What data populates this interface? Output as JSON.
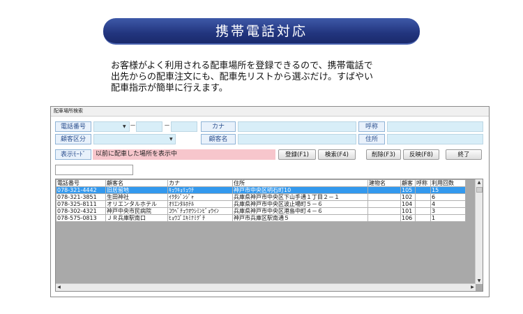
{
  "banner": {
    "title": "携帯電話対応"
  },
  "intro": {
    "lines": [
      "お客様がよく利用される配車場所を登録できるので、携帯電話で",
      "出先からの配車注文にも、配車先リストから選ぶだけ。すばやい",
      "配車指示が簡単に行えます。"
    ]
  },
  "window": {
    "title": "配車場所検索",
    "labels": {
      "phone": "電話番号",
      "kana": "カナ",
      "yobi": "呼称",
      "category": "顧客区分",
      "customer": "顧客名",
      "address": "住所",
      "mode": "表示ﾓｰﾄﾞ"
    },
    "phone_dash": "－",
    "mode_text": "以前に配車した場所を表示中",
    "buttons": {
      "register": "登録(F1)",
      "search": "検索(F4)",
      "delete": "削除(F3)",
      "reflect": "反映(F8)",
      "exit": "終了"
    },
    "table": {
      "headers": [
        "電話番号",
        "顧客名",
        "カナ",
        "住所",
        "建物名",
        "顧客",
        "呼称",
        "利用回数"
      ],
      "rows": [
        [
          "078-321-4442",
          "旧居留地",
          "ｷｭｳｷｮﾘｭｳﾁ",
          "神戸市中央区明石町10",
          "",
          "105",
          "",
          "15"
        ],
        [
          "078-321-3851",
          "生田神社",
          "ｲｸﾀｼﾞﾝｼﾞｬ",
          "兵庫県神戸市中央区下山手通１丁目２－１",
          "",
          "102",
          "",
          "6"
        ],
        [
          "078-325-8111",
          "オリエンタルホテル",
          "ｵﾘｴﾝﾀﾙﾎﾃﾙ",
          "兵庫県神戸市中央区波止場町５－６",
          "",
          "104",
          "",
          "4"
        ],
        [
          "078-302-4321",
          "神戸中央市民病院",
          "ｺｳﾍﾞﾁｭｳｵｳｼﾐﾝﾋﾞｮｳｲﾝ",
          "兵庫県神戸市中央区港島中町４－６",
          "",
          "101",
          "",
          "3"
        ],
        [
          "078-575-0813",
          "ＪＲ兵庫駅南口",
          "ﾋｮｳｺﾞｴｷﾐﾅﾐｸﾞﾁ",
          "神戸市兵庫区駅南通５",
          "",
          "106",
          "",
          "1"
        ]
      ],
      "selected_row": 0
    }
  }
}
